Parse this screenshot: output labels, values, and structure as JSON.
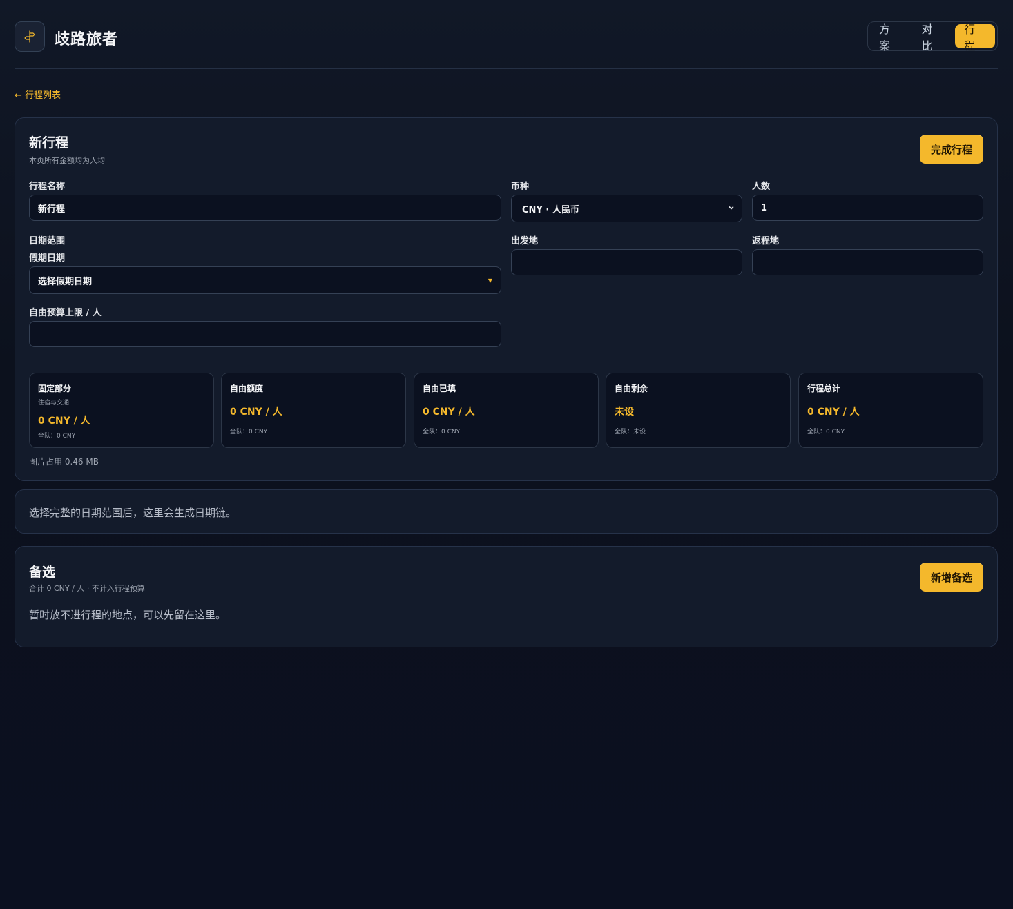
{
  "app": {
    "brand": "歧路旅者",
    "logo_icon": "signpost-icon",
    "accent": "#f4b82c"
  },
  "nav": {
    "items": [
      {
        "label": "方案",
        "active": false
      },
      {
        "label": "对比",
        "active": false
      },
      {
        "label": "行程",
        "active": true
      }
    ]
  },
  "back_link": "← 行程列表",
  "trip": {
    "title": "新行程",
    "subtitle": "本页所有金额均为人均",
    "finish_button": "完成行程",
    "fields": {
      "name": {
        "label": "行程名称",
        "value": "新行程"
      },
      "currency": {
        "label": "币种",
        "value": "CNY · 人民币"
      },
      "people": {
        "label": "人数",
        "value": "1"
      },
      "date_range": {
        "label": "日期范围",
        "sublabel": "假期日期",
        "value": "选择假期日期"
      },
      "origin": {
        "label": "出发地",
        "value": ""
      },
      "return": {
        "label": "返程地",
        "value": ""
      },
      "budget": {
        "label": "自由预算上限 / 人",
        "value": ""
      }
    },
    "stats": [
      {
        "title": "固定部分",
        "sub": "住宿与交通",
        "value": "0 CNY / 人",
        "team": "全队：0 CNY"
      },
      {
        "title": "自由额度",
        "sub": "",
        "value": "0 CNY / 人",
        "team": "全队：0 CNY"
      },
      {
        "title": "自由已填",
        "sub": "",
        "value": "0 CNY / 人",
        "team": "全队：0 CNY"
      },
      {
        "title": "自由剩余",
        "sub": "",
        "value": "未设",
        "team": "全队：未设"
      },
      {
        "title": "行程总计",
        "sub": "",
        "value": "0 CNY / 人",
        "team": "全队：0 CNY"
      }
    ],
    "image_usage": "图片占用 0.46 MB"
  },
  "date_chain": {
    "hint": "选择完整的日期范围后，这里会生成日期链。"
  },
  "alternatives": {
    "title": "备选",
    "summary": "合计 0 CNY / 人 · 不计入行程预算",
    "add_button": "新增备选",
    "empty_text": "暂时放不进行程的地点，可以先留在这里。"
  }
}
